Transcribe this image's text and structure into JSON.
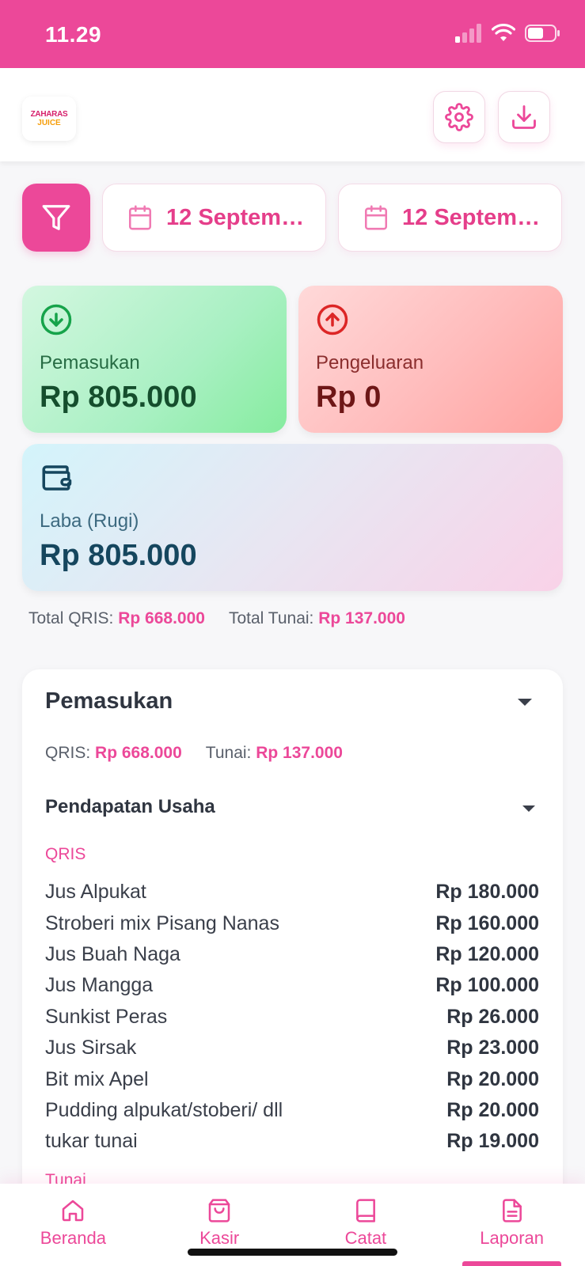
{
  "status_bar": {
    "time": "11.29"
  },
  "header": {
    "logo_text_1": "ZAHARAS",
    "logo_text_2": "JUICE",
    "settings_icon": "gear-icon",
    "download_icon": "download-icon"
  },
  "filters": {
    "filter_icon": "funnel-icon",
    "start_date": "12 Septem…",
    "end_date": "12 Septem…"
  },
  "cards": {
    "income": {
      "label": "Pemasukan",
      "value": "Rp 805.000"
    },
    "expense": {
      "label": "Pengeluaran",
      "value": "Rp 0"
    },
    "profit": {
      "label": "Laba (Rugi)",
      "value": "Rp 805.000"
    }
  },
  "totals": {
    "qris_label": "Total QRIS:",
    "qris_value": "Rp 668.000",
    "cash_label": "Total Tunai:",
    "cash_value": "Rp 137.000"
  },
  "section": {
    "title": "Pemasukan",
    "qris_label": "QRIS:",
    "qris_value": "Rp 668.000",
    "cash_label": "Tunai:",
    "cash_value": "Rp 137.000",
    "subsection_title": "Pendapatan Usaha",
    "group_qris": "QRIS",
    "group_cash": "Tunai",
    "items": [
      {
        "name": "Jus Alpukat",
        "amount": "Rp 180.000"
      },
      {
        "name": "Stroberi mix Pisang Nanas",
        "amount": "Rp 160.000"
      },
      {
        "name": "Jus Buah Naga",
        "amount": "Rp 120.000"
      },
      {
        "name": "Jus Mangga",
        "amount": "Rp 100.000"
      },
      {
        "name": "Sunkist Peras",
        "amount": "Rp 26.000"
      },
      {
        "name": "Jus Sirsak",
        "amount": "Rp 23.000"
      },
      {
        "name": "Bit mix Apel",
        "amount": "Rp 20.000"
      },
      {
        "name": "Pudding alpukat/stoberi/ dll",
        "amount": "Rp 20.000"
      },
      {
        "name": "tukar tunai",
        "amount": "Rp 19.000"
      }
    ]
  },
  "nav": [
    {
      "label": "Beranda",
      "icon": "home-icon"
    },
    {
      "label": "Kasir",
      "icon": "shopping-bag-icon"
    },
    {
      "label": "Catat",
      "icon": "book-icon"
    },
    {
      "label": "Laporan",
      "icon": "document-icon"
    }
  ],
  "colors": {
    "accent": "#ec4899",
    "income": "#86ec9f",
    "expense": "#ffa3a0"
  }
}
